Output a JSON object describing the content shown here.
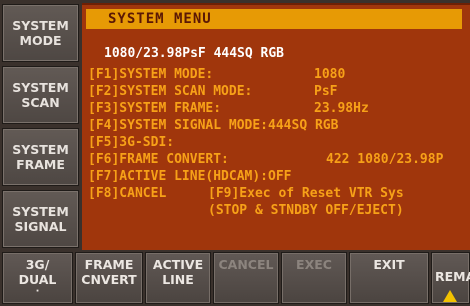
{
  "side_buttons": [
    {
      "line1": "SYSTEM",
      "line2": "MODE"
    },
    {
      "line1": "SYSTEM",
      "line2": "SCAN"
    },
    {
      "line1": "SYSTEM",
      "line2": "FRAME"
    },
    {
      "line1": "SYSTEM",
      "line2": "SIGNAL"
    }
  ],
  "menu": {
    "title": "SYSTEM MENU",
    "status": "1080/23.98PsF 444SQ RGB",
    "rows": [
      {
        "label": "[F1]SYSTEM MODE:",
        "value": "1080"
      },
      {
        "label": "[F2]SYSTEM SCAN MODE:",
        "value": "PsF"
      },
      {
        "label": "[F3]SYSTEM FRAME:",
        "value": "23.98Hz"
      },
      {
        "label": "[F4]SYSTEM SIGNAL MODE:444SQ RGB",
        "value": ""
      },
      {
        "label": "[F5]3G-SDI:",
        "value": ""
      },
      {
        "label": "[F6]FRAME CONVERT:",
        "value": "422 1080/23.98P"
      },
      {
        "label": "[F7]ACTIVE LINE(HDCAM):OFF",
        "value": ""
      },
      {
        "label": "[F8]CANCEL",
        "value": "[F9]Exec of Reset VTR Sys"
      },
      {
        "label": "",
        "value": "(STOP & STNDBY OFF/EJECT)"
      }
    ]
  },
  "soft_keys": [
    {
      "line1": "3G/",
      "line2": "DUAL",
      "enabled": true
    },
    {
      "line1": "FRAME",
      "line2": "CNVERT",
      "enabled": true
    },
    {
      "line1": "ACTIVE",
      "line2": "LINE",
      "enabled": true
    },
    {
      "line1": "CANCEL",
      "line2": "",
      "enabled": false
    },
    {
      "line1": "EXEC",
      "line2": "",
      "enabled": false
    },
    {
      "line1": "EXIT",
      "line2": "",
      "enabled": true
    },
    {
      "line1": "REMA",
      "line2": "",
      "enabled": true
    }
  ],
  "colors": {
    "panel_bg": "#a0360c",
    "header_bg": "#e79a05",
    "menu_text": "#f7a118",
    "status_text": "#ffffff"
  },
  "icons": {
    "warning": "warning-icon"
  }
}
